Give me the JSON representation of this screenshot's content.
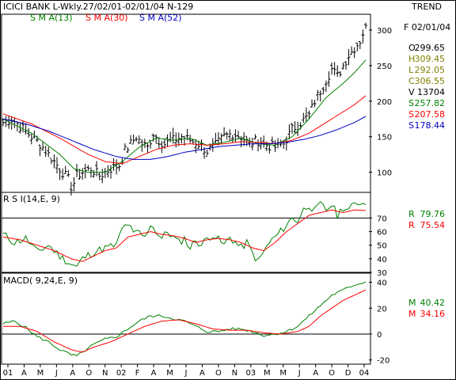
{
  "header": {
    "title": "ICICI BANK L-Wkly.27/02/01-02/01/04  N-129",
    "trend_label": "TREND"
  },
  "price_panel": {
    "legend": [
      {
        "text": "S M A(13)",
        "color": "#008000"
      },
      {
        "text": "S M A(30)",
        "color": "#ff0000"
      },
      {
        "text": "S M A(52)",
        "color": "#0000c0"
      }
    ],
    "date_label": "F 02/01/04",
    "readouts": [
      {
        "label": "O",
        "value": "299.65",
        "color": "#000000"
      },
      {
        "label": "H",
        "value": "309.45",
        "color": "#808000"
      },
      {
        "label": "L",
        "value": "292.05",
        "color": "#808000"
      },
      {
        "label": "C",
        "value": "306.55",
        "color": "#808000"
      },
      {
        "label": "V",
        "value": "13704",
        "color": "#000000"
      },
      {
        "label": "S",
        "value": "257.82",
        "color": "#008000"
      },
      {
        "label": "S",
        "value": "207.58",
        "color": "#ff0000"
      },
      {
        "label": "S",
        "value": "178.44",
        "color": "#0000c0"
      }
    ]
  },
  "rsi_panel": {
    "label": "R S I(14,E, 9)",
    "readouts": [
      {
        "label": "R",
        "value": "79.76",
        "color": "#008000"
      },
      {
        "label": "R",
        "value": "75.54",
        "color": "#ff0000"
      }
    ]
  },
  "macd_panel": {
    "label": "MACD( 9,24,E, 9)",
    "readouts": [
      {
        "label": "M",
        "value": "40.42",
        "color": "#008000"
      },
      {
        "label": "M",
        "value": "34.16",
        "color": "#ff0000"
      }
    ]
  },
  "x_axis_labels": [
    "01",
    "A",
    "M",
    "J",
    "A",
    "O",
    "N",
    "02",
    "F",
    "A",
    "M",
    "J",
    "A",
    "O",
    "N",
    "03",
    "M",
    "M",
    "J",
    "A",
    "O",
    "D",
    "04"
  ],
  "chart_data": [
    {
      "type": "line",
      "title": "ICICI BANK L-Wkly.27/02/01-02/01/04  N-129",
      "ylim": [
        75,
        320
      ],
      "y_ticks": [
        100,
        150,
        200,
        250,
        300
      ],
      "candles_close_anchors": [
        [
          0,
          170
        ],
        [
          3,
          175
        ],
        [
          6,
          165
        ],
        [
          10,
          150
        ],
        [
          13,
          140
        ],
        [
          16,
          125
        ],
        [
          19,
          110
        ],
        [
          21,
          100
        ],
        [
          23,
          90
        ],
        [
          24,
          80
        ],
        [
          25,
          85
        ],
        [
          26,
          95
        ],
        [
          28,
          100
        ],
        [
          31,
          105
        ],
        [
          34,
          95
        ],
        [
          36,
          100
        ],
        [
          38,
          105
        ],
        [
          41,
          110
        ],
        [
          43,
          130
        ],
        [
          45,
          140
        ],
        [
          47,
          150
        ],
        [
          49,
          140
        ],
        [
          51,
          135
        ],
        [
          53,
          155
        ],
        [
          55,
          145
        ],
        [
          57,
          140
        ],
        [
          60,
          145
        ],
        [
          63,
          150
        ],
        [
          66,
          145
        ],
        [
          69,
          140
        ],
        [
          72,
          130
        ],
        [
          75,
          138
        ],
        [
          78,
          150
        ],
        [
          81,
          155
        ],
        [
          84,
          150
        ],
        [
          87,
          140
        ],
        [
          90,
          145
        ],
        [
          93,
          138
        ],
        [
          96,
          135
        ],
        [
          99,
          140
        ],
        [
          102,
          160
        ],
        [
          105,
          170
        ],
        [
          108,
          180
        ],
        [
          110,
          200
        ],
        [
          112,
          215
        ],
        [
          114,
          230
        ],
        [
          116,
          245
        ],
        [
          118,
          235
        ],
        [
          120,
          250
        ],
        [
          122,
          265
        ],
        [
          124,
          275
        ],
        [
          126,
          285
        ],
        [
          128,
          306.55
        ]
      ],
      "series": [
        {
          "name": "S M A(13)",
          "color": "#008000",
          "anchors": [
            [
              0,
              175
            ],
            [
              10,
              155
            ],
            [
              20,
              125
            ],
            [
              25,
              105
            ],
            [
              30,
              100
            ],
            [
              36,
              100
            ],
            [
              42,
              115
            ],
            [
              48,
              135
            ],
            [
              54,
              148
            ],
            [
              60,
              145
            ],
            [
              66,
              148
            ],
            [
              72,
              138
            ],
            [
              78,
              142
            ],
            [
              84,
              148
            ],
            [
              90,
              140
            ],
            [
              96,
              138
            ],
            [
              102,
              150
            ],
            [
              108,
              175
            ],
            [
              114,
              205
            ],
            [
              120,
              225
            ],
            [
              124,
              240
            ],
            [
              128,
              257.82
            ]
          ]
        },
        {
          "name": "S M A(30)",
          "color": "#ff0000",
          "anchors": [
            [
              0,
              182
            ],
            [
              10,
              168
            ],
            [
              20,
              148
            ],
            [
              30,
              125
            ],
            [
              36,
              115
            ],
            [
              42,
              112
            ],
            [
              48,
              122
            ],
            [
              54,
              132
            ],
            [
              60,
              138
            ],
            [
              66,
              140
            ],
            [
              72,
              138
            ],
            [
              78,
              140
            ],
            [
              84,
              143
            ],
            [
              90,
              142
            ],
            [
              96,
              140
            ],
            [
              102,
              145
            ],
            [
              108,
              155
            ],
            [
              114,
              170
            ],
            [
              120,
              185
            ],
            [
              124,
              195
            ],
            [
              128,
              207.58
            ]
          ]
        },
        {
          "name": "S M A(52)",
          "color": "#0000c0",
          "anchors": [
            [
              0,
              175
            ],
            [
              8,
              168
            ],
            [
              16,
              158
            ],
            [
              24,
              145
            ],
            [
              32,
              132
            ],
            [
              40,
              122
            ],
            [
              46,
              118
            ],
            [
              52,
              118
            ],
            [
              58,
              122
            ],
            [
              64,
              128
            ],
            [
              70,
              132
            ],
            [
              76,
              136
            ],
            [
              82,
              138
            ],
            [
              88,
              140
            ],
            [
              94,
              140
            ],
            [
              100,
              142
            ],
            [
              106,
              146
            ],
            [
              112,
              152
            ],
            [
              118,
              160
            ],
            [
              124,
              170
            ],
            [
              128,
              178.44
            ]
          ]
        }
      ]
    },
    {
      "type": "line",
      "title": "R S I(14,E, 9)",
      "ylim": [
        30,
        86
      ],
      "y_ticks": [
        30,
        40,
        50,
        60,
        70
      ],
      "reference_lines": [
        30,
        70
      ],
      "series": [
        {
          "name": "R",
          "color": "#008000",
          "anchors": [
            [
              0,
              58
            ],
            [
              4,
              52
            ],
            [
              8,
              55
            ],
            [
              12,
              45
            ],
            [
              16,
              50
            ],
            [
              20,
              42
            ],
            [
              24,
              36
            ],
            [
              26,
              34
            ],
            [
              28,
              40
            ],
            [
              32,
              45
            ],
            [
              36,
              48
            ],
            [
              40,
              50
            ],
            [
              42,
              62
            ],
            [
              44,
              66
            ],
            [
              46,
              58
            ],
            [
              48,
              60
            ],
            [
              50,
              55
            ],
            [
              52,
              66
            ],
            [
              54,
              60
            ],
            [
              56,
              55
            ],
            [
              58,
              60
            ],
            [
              60,
              56
            ],
            [
              62,
              52
            ],
            [
              64,
              55
            ],
            [
              66,
              48
            ],
            [
              68,
              54
            ],
            [
              70,
              50
            ],
            [
              72,
              55
            ],
            [
              74,
              58
            ],
            [
              76,
              54
            ],
            [
              78,
              50
            ],
            [
              80,
              56
            ],
            [
              82,
              52
            ],
            [
              84,
              48
            ],
            [
              86,
              52
            ],
            [
              88,
              44
            ],
            [
              90,
              38
            ],
            [
              92,
              45
            ],
            [
              94,
              52
            ],
            [
              96,
              56
            ],
            [
              98,
              60
            ],
            [
              100,
              65
            ],
            [
              102,
              70
            ],
            [
              104,
              68
            ],
            [
              106,
              76
            ],
            [
              108,
              80
            ],
            [
              110,
              75
            ],
            [
              112,
              80
            ],
            [
              114,
              76
            ],
            [
              116,
              80
            ],
            [
              118,
              72
            ],
            [
              120,
              78
            ],
            [
              122,
              76
            ],
            [
              124,
              80
            ],
            [
              126,
              82
            ],
            [
              128,
              79.76
            ]
          ]
        },
        {
          "name": "R",
          "color": "#ff0000",
          "anchors": [
            [
              0,
              56
            ],
            [
              6,
              54
            ],
            [
              12,
              50
            ],
            [
              18,
              46
            ],
            [
              24,
              40
            ],
            [
              28,
              38
            ],
            [
              32,
              42
            ],
            [
              36,
              46
            ],
            [
              40,
              48
            ],
            [
              44,
              56
            ],
            [
              48,
              58
            ],
            [
              52,
              60
            ],
            [
              56,
              58
            ],
            [
              60,
              57
            ],
            [
              64,
              55
            ],
            [
              68,
              52
            ],
            [
              72,
              54
            ],
            [
              76,
              55
            ],
            [
              80,
              54
            ],
            [
              84,
              52
            ],
            [
              88,
              48
            ],
            [
              92,
              46
            ],
            [
              96,
              52
            ],
            [
              100,
              60
            ],
            [
              104,
              66
            ],
            [
              108,
              72
            ],
            [
              112,
              74
            ],
            [
              116,
              76
            ],
            [
              120,
              74
            ],
            [
              124,
              76
            ],
            [
              128,
              75.54
            ]
          ]
        }
      ]
    },
    {
      "type": "line",
      "title": "MACD( 9,24,E, 9)",
      "ylim": [
        -22,
        44
      ],
      "y_ticks": [
        -20,
        0,
        20,
        40
      ],
      "reference_lines": [
        0
      ],
      "series": [
        {
          "name": "M",
          "color": "#008000",
          "anchors": [
            [
              0,
              8
            ],
            [
              4,
              10
            ],
            [
              8,
              5
            ],
            [
              12,
              -2
            ],
            [
              16,
              -6
            ],
            [
              20,
              -12
            ],
            [
              24,
              -16
            ],
            [
              26,
              -17
            ],
            [
              28,
              -14
            ],
            [
              32,
              -8
            ],
            [
              36,
              -4
            ],
            [
              40,
              -2
            ],
            [
              44,
              4
            ],
            [
              48,
              10
            ],
            [
              52,
              14
            ],
            [
              56,
              14
            ],
            [
              60,
              12
            ],
            [
              64,
              10
            ],
            [
              68,
              6
            ],
            [
              72,
              2
            ],
            [
              76,
              2
            ],
            [
              80,
              4
            ],
            [
              84,
              4
            ],
            [
              88,
              2
            ],
            [
              92,
              -1
            ],
            [
              96,
              0
            ],
            [
              100,
              2
            ],
            [
              104,
              6
            ],
            [
              108,
              14
            ],
            [
              112,
              22
            ],
            [
              116,
              30
            ],
            [
              120,
              34
            ],
            [
              124,
              38
            ],
            [
              128,
              40.42
            ]
          ]
        },
        {
          "name": "M",
          "color": "#ff0000",
          "anchors": [
            [
              0,
              6
            ],
            [
              6,
              6
            ],
            [
              12,
              2
            ],
            [
              18,
              -6
            ],
            [
              24,
              -12
            ],
            [
              28,
              -14
            ],
            [
              32,
              -10
            ],
            [
              38,
              -6
            ],
            [
              44,
              0
            ],
            [
              50,
              6
            ],
            [
              56,
              10
            ],
            [
              62,
              11
            ],
            [
              68,
              8
            ],
            [
              74,
              4
            ],
            [
              80,
              3
            ],
            [
              86,
              3
            ],
            [
              92,
              1
            ],
            [
              98,
              0
            ],
            [
              104,
              2
            ],
            [
              108,
              6
            ],
            [
              112,
              14
            ],
            [
              116,
              20
            ],
            [
              120,
              26
            ],
            [
              124,
              30
            ],
            [
              128,
              34.16
            ]
          ]
        }
      ]
    }
  ]
}
